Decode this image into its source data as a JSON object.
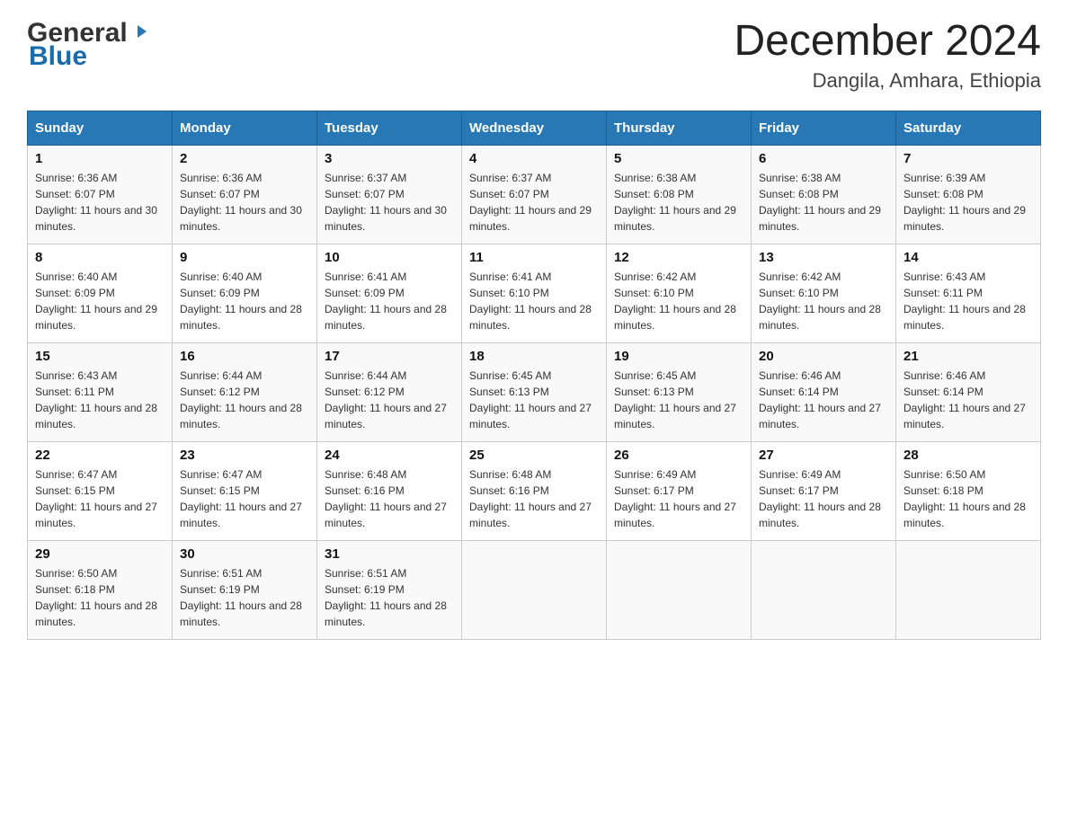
{
  "logo": {
    "general": "General",
    "blue": "Blue"
  },
  "title": {
    "month_year": "December 2024",
    "location": "Dangila, Amhara, Ethiopia"
  },
  "columns": [
    "Sunday",
    "Monday",
    "Tuesday",
    "Wednesday",
    "Thursday",
    "Friday",
    "Saturday"
  ],
  "weeks": [
    [
      {
        "day": "1",
        "sunrise": "6:36 AM",
        "sunset": "6:07 PM",
        "daylight": "11 hours and 30 minutes."
      },
      {
        "day": "2",
        "sunrise": "6:36 AM",
        "sunset": "6:07 PM",
        "daylight": "11 hours and 30 minutes."
      },
      {
        "day": "3",
        "sunrise": "6:37 AM",
        "sunset": "6:07 PM",
        "daylight": "11 hours and 30 minutes."
      },
      {
        "day": "4",
        "sunrise": "6:37 AM",
        "sunset": "6:07 PM",
        "daylight": "11 hours and 29 minutes."
      },
      {
        "day": "5",
        "sunrise": "6:38 AM",
        "sunset": "6:08 PM",
        "daylight": "11 hours and 29 minutes."
      },
      {
        "day": "6",
        "sunrise": "6:38 AM",
        "sunset": "6:08 PM",
        "daylight": "11 hours and 29 minutes."
      },
      {
        "day": "7",
        "sunrise": "6:39 AM",
        "sunset": "6:08 PM",
        "daylight": "11 hours and 29 minutes."
      }
    ],
    [
      {
        "day": "8",
        "sunrise": "6:40 AM",
        "sunset": "6:09 PM",
        "daylight": "11 hours and 29 minutes."
      },
      {
        "day": "9",
        "sunrise": "6:40 AM",
        "sunset": "6:09 PM",
        "daylight": "11 hours and 28 minutes."
      },
      {
        "day": "10",
        "sunrise": "6:41 AM",
        "sunset": "6:09 PM",
        "daylight": "11 hours and 28 minutes."
      },
      {
        "day": "11",
        "sunrise": "6:41 AM",
        "sunset": "6:10 PM",
        "daylight": "11 hours and 28 minutes."
      },
      {
        "day": "12",
        "sunrise": "6:42 AM",
        "sunset": "6:10 PM",
        "daylight": "11 hours and 28 minutes."
      },
      {
        "day": "13",
        "sunrise": "6:42 AM",
        "sunset": "6:10 PM",
        "daylight": "11 hours and 28 minutes."
      },
      {
        "day": "14",
        "sunrise": "6:43 AM",
        "sunset": "6:11 PM",
        "daylight": "11 hours and 28 minutes."
      }
    ],
    [
      {
        "day": "15",
        "sunrise": "6:43 AM",
        "sunset": "6:11 PM",
        "daylight": "11 hours and 28 minutes."
      },
      {
        "day": "16",
        "sunrise": "6:44 AM",
        "sunset": "6:12 PM",
        "daylight": "11 hours and 28 minutes."
      },
      {
        "day": "17",
        "sunrise": "6:44 AM",
        "sunset": "6:12 PM",
        "daylight": "11 hours and 27 minutes."
      },
      {
        "day": "18",
        "sunrise": "6:45 AM",
        "sunset": "6:13 PM",
        "daylight": "11 hours and 27 minutes."
      },
      {
        "day": "19",
        "sunrise": "6:45 AM",
        "sunset": "6:13 PM",
        "daylight": "11 hours and 27 minutes."
      },
      {
        "day": "20",
        "sunrise": "6:46 AM",
        "sunset": "6:14 PM",
        "daylight": "11 hours and 27 minutes."
      },
      {
        "day": "21",
        "sunrise": "6:46 AM",
        "sunset": "6:14 PM",
        "daylight": "11 hours and 27 minutes."
      }
    ],
    [
      {
        "day": "22",
        "sunrise": "6:47 AM",
        "sunset": "6:15 PM",
        "daylight": "11 hours and 27 minutes."
      },
      {
        "day": "23",
        "sunrise": "6:47 AM",
        "sunset": "6:15 PM",
        "daylight": "11 hours and 27 minutes."
      },
      {
        "day": "24",
        "sunrise": "6:48 AM",
        "sunset": "6:16 PM",
        "daylight": "11 hours and 27 minutes."
      },
      {
        "day": "25",
        "sunrise": "6:48 AM",
        "sunset": "6:16 PM",
        "daylight": "11 hours and 27 minutes."
      },
      {
        "day": "26",
        "sunrise": "6:49 AM",
        "sunset": "6:17 PM",
        "daylight": "11 hours and 27 minutes."
      },
      {
        "day": "27",
        "sunrise": "6:49 AM",
        "sunset": "6:17 PM",
        "daylight": "11 hours and 28 minutes."
      },
      {
        "day": "28",
        "sunrise": "6:50 AM",
        "sunset": "6:18 PM",
        "daylight": "11 hours and 28 minutes."
      }
    ],
    [
      {
        "day": "29",
        "sunrise": "6:50 AM",
        "sunset": "6:18 PM",
        "daylight": "11 hours and 28 minutes."
      },
      {
        "day": "30",
        "sunrise": "6:51 AM",
        "sunset": "6:19 PM",
        "daylight": "11 hours and 28 minutes."
      },
      {
        "day": "31",
        "sunrise": "6:51 AM",
        "sunset": "6:19 PM",
        "daylight": "11 hours and 28 minutes."
      },
      null,
      null,
      null,
      null
    ]
  ]
}
